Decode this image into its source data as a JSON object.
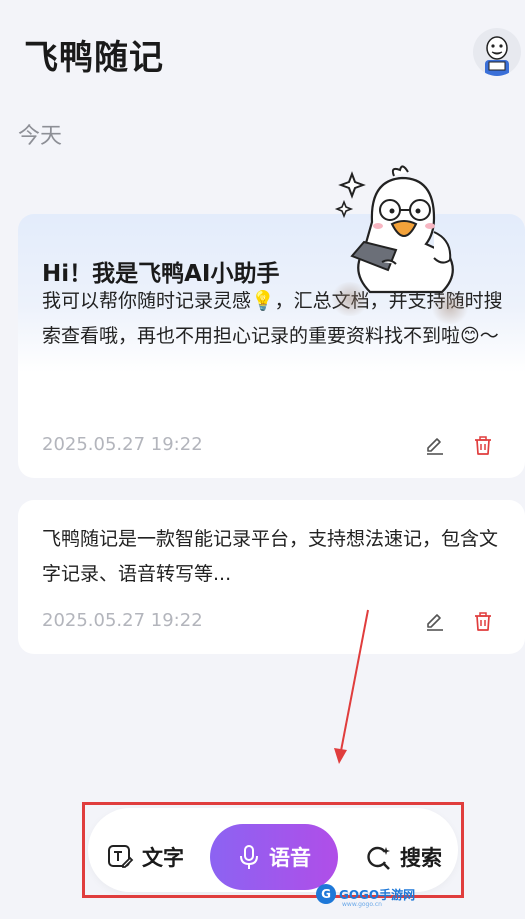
{
  "header": {
    "title": "飞鸭随记",
    "avatar_icon": "duck-avatar-icon"
  },
  "section": {
    "label": "今天"
  },
  "notes": [
    {
      "title": "Hi！我是飞鸭AI小助手",
      "body": "我可以帮你随时记录灵感💡，汇总文档，并支持随时搜索查看哦，再也不用担心记录的重要资料找不到啦😊～",
      "time": "2025.05.27 19:22",
      "mascot_icon": "duck-mascot-icon"
    },
    {
      "body": "飞鸭随记是一款智能记录平台，支持想法速记，包含文字记录、语音转写等...",
      "time": "2025.05.27 19:22"
    }
  ],
  "bottom_bar": {
    "text_label": "文字",
    "voice_label": "语音",
    "search_label": "搜索"
  },
  "watermark": {
    "text": "GOGO手游网",
    "sub": "www.gogo.cn"
  },
  "colors": {
    "accent_start": "#8c63f2",
    "accent_end": "#b04ee8",
    "delete": "#e03d3d",
    "highlight_frame": "#e03d3d"
  }
}
